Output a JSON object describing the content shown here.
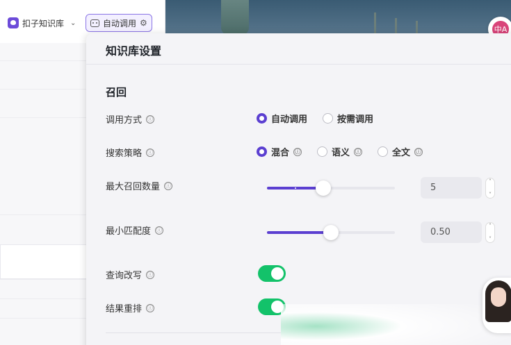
{
  "toolbar": {
    "kb_selector_label": "扣子知识库",
    "auto_chip_label": "自动调用",
    "chevron": "⌄"
  },
  "translate_button": {
    "label": "中A"
  },
  "settings": {
    "title": "知识库设置",
    "section_title": "召回",
    "call_mode": {
      "label": "调用方式",
      "options": [
        "自动调用",
        "按需调用"
      ],
      "selected": "自动调用"
    },
    "search_strategy": {
      "label": "搜索策略",
      "options": [
        "混合",
        "语义",
        "全文"
      ],
      "selected": "混合"
    },
    "max_recall": {
      "label": "最大召回数量",
      "value": "5",
      "slider_fraction": 0.44
    },
    "min_match": {
      "label": "最小匹配度",
      "value": "0.50",
      "slider_fraction": 0.5
    },
    "query_rewrite": {
      "label": "查询改写",
      "enabled": true
    },
    "rerank": {
      "label": "结果重排",
      "enabled": true
    }
  },
  "colors": {
    "accent": "#5b3fd1",
    "toggle_on": "#13c26a",
    "panel_bg": "#f4f4f7"
  },
  "icons": {
    "info": "ⓘ",
    "stepper_up": "˄",
    "stepper_down": "˅",
    "gear": "⚙"
  }
}
